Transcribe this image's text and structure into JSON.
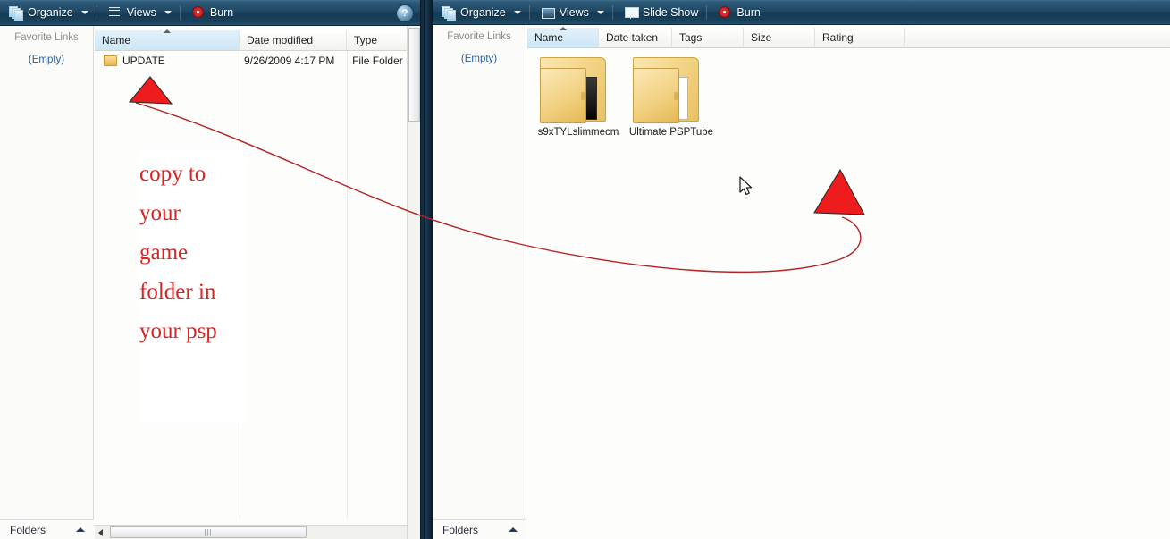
{
  "left_window": {
    "toolbar": {
      "organize": "Organize",
      "views": "Views",
      "burn": "Burn",
      "help": "?"
    },
    "sidebar": {
      "title": "Favorite Links",
      "empty": "(Empty)",
      "folders": "Folders"
    },
    "columns": [
      "Name",
      "Date modified",
      "Type"
    ],
    "rows": [
      {
        "name": "UPDATE",
        "date_modified": "9/26/2009 4:17 PM",
        "type": "File Folder"
      }
    ]
  },
  "right_window": {
    "toolbar": {
      "organize": "Organize",
      "views": "Views",
      "slide_show": "Slide Show",
      "burn": "Burn"
    },
    "sidebar": {
      "title": "Favorite Links",
      "empty": "(Empty)",
      "folders": "Folders"
    },
    "columns": [
      "Name",
      "Date taken",
      "Tags",
      "Size",
      "Rating"
    ],
    "items": [
      {
        "label": "s9xTYLslimmecm"
      },
      {
        "label": "Ultimate PSPTube"
      }
    ]
  },
  "annotation": {
    "text": "copy to\nyour\ngame\nfolder in\nyour psp",
    "color": "#dd2222"
  },
  "scrollbar": {
    "grip": "|||"
  }
}
